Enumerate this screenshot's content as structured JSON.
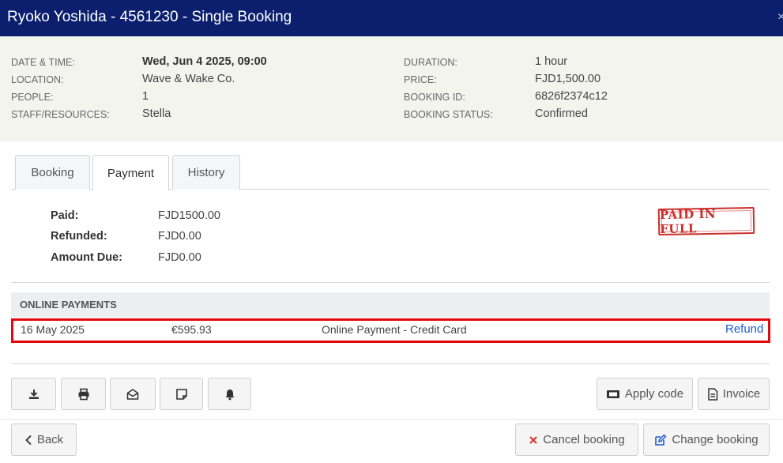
{
  "header": {
    "title": "Ryoko Yoshida - 4561230 - Single Booking",
    "close_glyph": "×"
  },
  "summary": {
    "left": [
      {
        "label": "DATE & TIME:",
        "value": "Wed, Jun 4 2025, 09:00"
      },
      {
        "label": "LOCATION:",
        "value": "Wave & Wake Co."
      },
      {
        "label": "PEOPLE:",
        "value": "1"
      },
      {
        "label": "STAFF/RESOURCES:",
        "value": "Stella"
      }
    ],
    "right": [
      {
        "label": "DURATION:",
        "value": "1 hour"
      },
      {
        "label": "PRICE:",
        "value": "FJD1,500.00"
      },
      {
        "label": "BOOKING ID:",
        "value": "6826f2374c12"
      },
      {
        "label": "BOOKING STATUS:",
        "value": "Confirmed"
      }
    ]
  },
  "tabs": [
    {
      "label": "Booking",
      "active": false
    },
    {
      "label": "Payment",
      "active": true
    },
    {
      "label": "History",
      "active": false
    }
  ],
  "payment": {
    "paid_label": "Paid:",
    "paid_value": "FJD1500.00",
    "refunded_label": "Refunded:",
    "refunded_value": "FJD0.00",
    "due_label": "Amount Due:",
    "due_value": "FJD0.00",
    "stamp_text": "PAID IN FULL"
  },
  "online_payments": {
    "header": "ONLINE PAYMENTS",
    "rows": [
      {
        "date": "16 May 2025",
        "amount": "€595.93",
        "method": "Online Payment - Credit Card",
        "action": "Refund"
      }
    ]
  },
  "toolbar": {
    "icons": [
      "download-icon",
      "print-icon",
      "envelope-open-icon",
      "note-icon",
      "bell-icon"
    ],
    "apply_code_label": "Apply code",
    "invoice_label": "Invoice"
  },
  "footer": {
    "back_label": "Back",
    "cancel_label": "Cancel booking",
    "change_label": "Change booking"
  },
  "colors": {
    "header_bg": "#0b1f6e",
    "accent_link": "#1f5bd4",
    "stamp_red": "#c9302c",
    "highlight_red": "#e3070e"
  }
}
